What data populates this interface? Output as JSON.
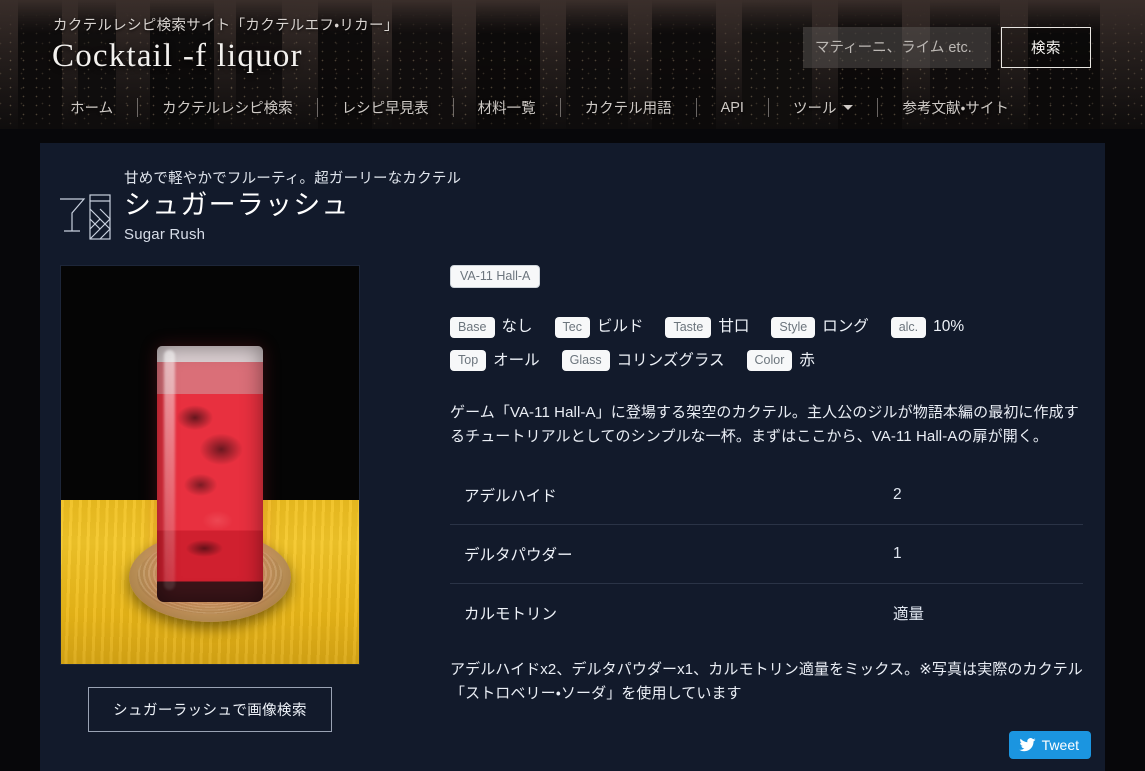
{
  "header": {
    "tagline": "カクテルレシピ検索サイト「カクテルエフ・リカー」",
    "logo": "Cocktail -f liquor",
    "search": {
      "placeholder": "マティーニ、ライム etc.",
      "value": "",
      "button_label": "検索"
    },
    "nav": [
      {
        "label": "ホーム"
      },
      {
        "label": "カクテルレシピ検索"
      },
      {
        "label": "レシピ早見表"
      },
      {
        "label": "材料一覧"
      },
      {
        "label": "カクテル用語"
      },
      {
        "label": "API"
      },
      {
        "label": "ツール",
        "has_caret": true
      },
      {
        "label": "参考文献・サイト"
      }
    ]
  },
  "recipe": {
    "tagline": "甘めで軽やかでフルーティ。超ガーリーなカクテル",
    "name_ja": "シュガーラッシュ",
    "name_en": "Sugar Rush",
    "series_tag": "VA-11 Hall-A",
    "attributes": [
      {
        "key": "Base",
        "value": "なし"
      },
      {
        "key": "Tec",
        "value": "ビルド"
      },
      {
        "key": "Taste",
        "value": "甘口"
      },
      {
        "key": "Style",
        "value": "ロング"
      },
      {
        "key": "alc.",
        "value": "10%"
      },
      {
        "key": "Top",
        "value": "オール"
      },
      {
        "key": "Glass",
        "value": "コリンズグラス"
      },
      {
        "key": "Color",
        "value": "赤"
      }
    ],
    "description": "ゲーム「VA-11 Hall-A」に登場する架空のカクテル。主人公のジルが物語本編の最初に作成するチュートリアルとしてのシンプルな一杯。まずはここから、VA-11 Hall-Aの扉が開く。",
    "ingredients": [
      {
        "name": "アデルハイド",
        "qty": "2"
      },
      {
        "name": "デルタパウダー",
        "qty": "1"
      },
      {
        "name": "カルモトリン",
        "qty": "適量"
      }
    ],
    "method": "アデルハイドx2、デルタパウダーx1、カルモトリン適量をミックス。※写真は実際のカクテル「ストロベリー・ソーダ」を使用しています",
    "image_search_label": "シュガーラッシュで画像検索"
  },
  "share": {
    "tweet_label": "Tweet"
  },
  "colors": {
    "page_background": "#07070a",
    "panel_background": "#121a2b",
    "tag_background": "#f7f8f9",
    "tag_text": "#6c757d",
    "tweet_blue": "#1b95e0",
    "drink_red": "#e8303f",
    "table_yellow": "#f0c020"
  }
}
